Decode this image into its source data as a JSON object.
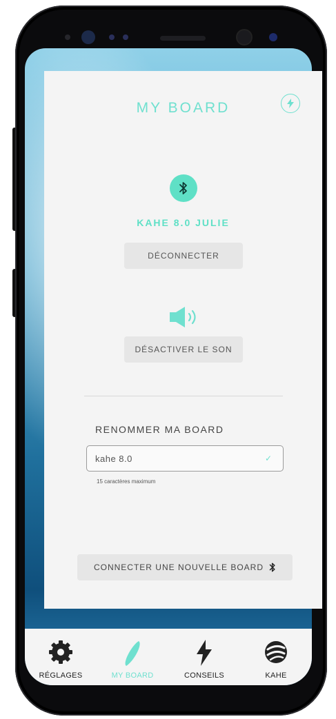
{
  "app": {
    "title": "MY BOARD"
  },
  "board": {
    "name": "KAHE 8.0 JULIE",
    "disconnect_label": "DÉCONNECTER",
    "sound_label": "DÉSACTIVER LE SON"
  },
  "rename": {
    "label": "RENOMMER MA BOARD",
    "value": "kahe 8.0",
    "hint": "15 caractères maximum"
  },
  "connect_new": {
    "label": "CONNECTER UNE NOUVELLE BOARD"
  },
  "tabs": [
    {
      "label": "RÉGLAGES",
      "icon": "gear-icon",
      "active": false
    },
    {
      "label": "MY BOARD",
      "icon": "surfboard-icon",
      "active": true
    },
    {
      "label": "CONSEILS",
      "icon": "lightning-icon",
      "active": false
    },
    {
      "label": "KAHE",
      "icon": "kahe-logo-icon",
      "active": false
    }
  ],
  "colors": {
    "accent": "#6fe0cf",
    "card": "#f4f4f4",
    "button": "#e6e6e6"
  }
}
